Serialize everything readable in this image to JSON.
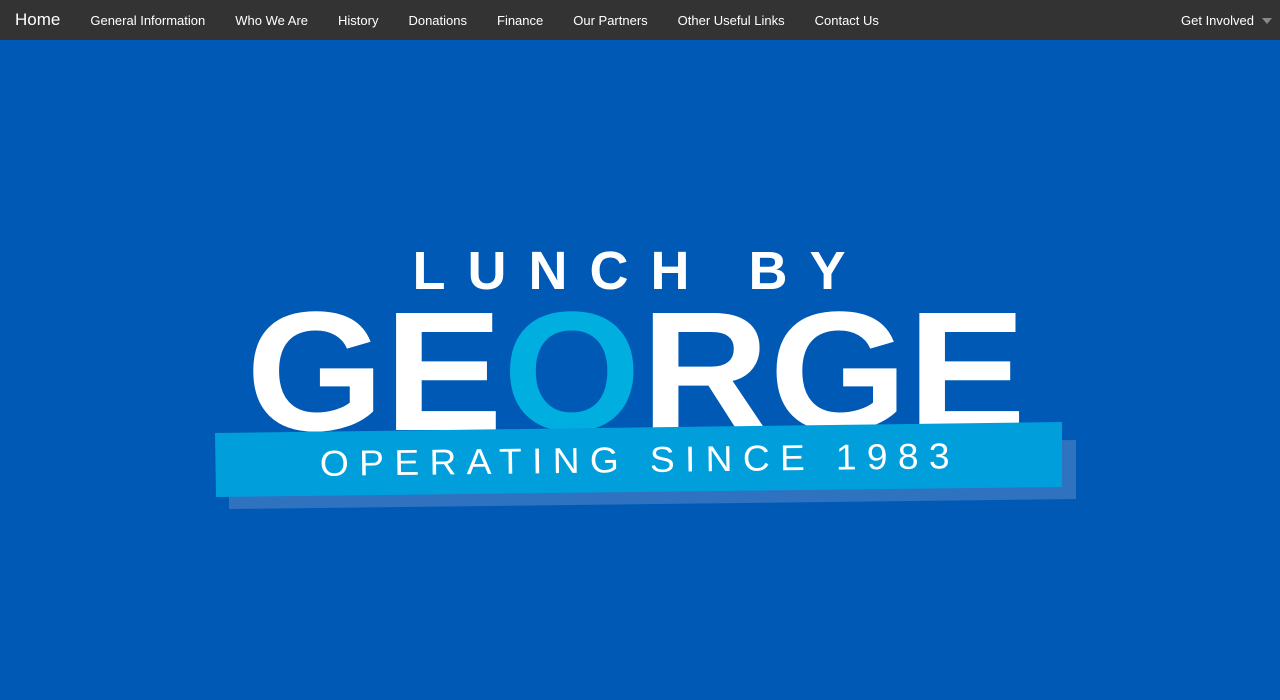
{
  "navbar": {
    "brand": "Home",
    "items": [
      {
        "label": "General Information"
      },
      {
        "label": "Who We Are"
      },
      {
        "label": "History"
      },
      {
        "label": "Donations"
      },
      {
        "label": "Finance"
      },
      {
        "label": "Our Partners"
      },
      {
        "label": "Other Useful Links"
      },
      {
        "label": "Contact Us"
      }
    ],
    "dropdown_label": "Get Involved",
    "dropdown_icon": "caret-down-icon"
  },
  "logo": {
    "line1": "LUNCH BY",
    "name_part1": "GE",
    "name_highlight": "O",
    "name_part2": "RGE",
    "tagline": "OPERATING SINCE 1983"
  },
  "colors": {
    "background": "#005ab5",
    "navbar": "#333333",
    "banner": "#009fdb",
    "banner_shadow": "#2f73c0",
    "highlight_letter": "#00aee0",
    "text": "#ffffff"
  }
}
